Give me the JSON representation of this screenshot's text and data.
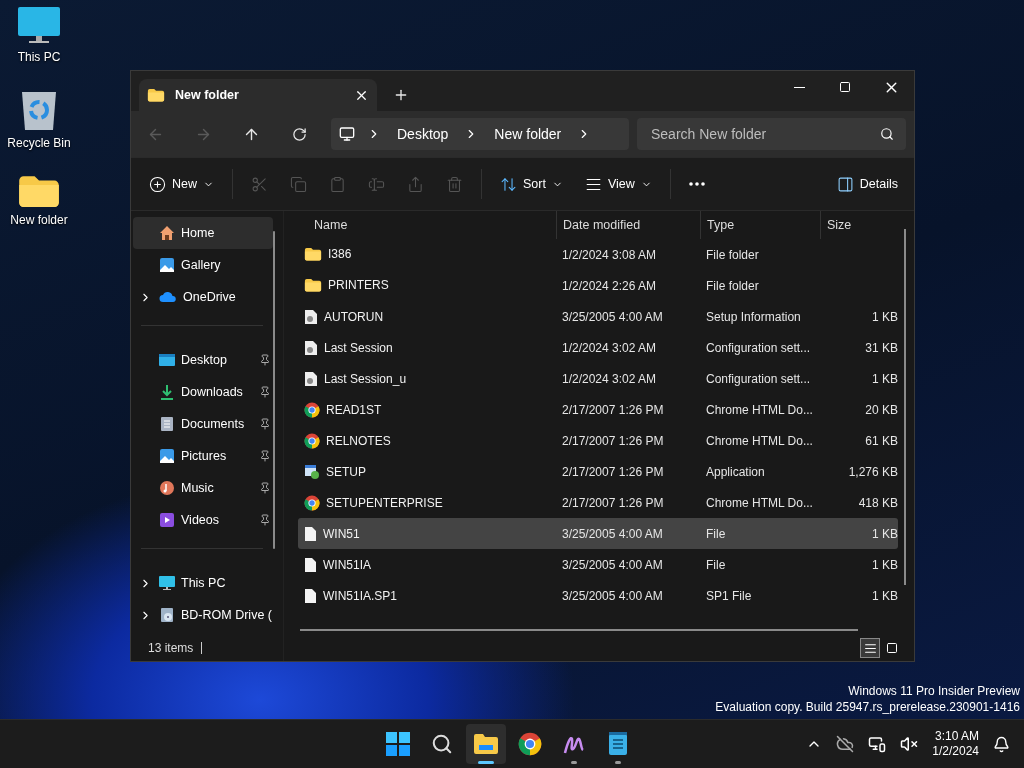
{
  "desktop_icons": [
    {
      "kind": "pc",
      "label": "This PC"
    },
    {
      "kind": "bin",
      "label": "Recycle Bin"
    },
    {
      "kind": "folder",
      "label": "New folder"
    }
  ],
  "window": {
    "tab": {
      "title": "New folder",
      "selected": true
    },
    "breadcrumb": [
      "Desktop",
      "New folder"
    ],
    "search": {
      "placeholder": "Search New folder"
    },
    "toolbar": [
      {
        "kind": "new",
        "label": "New",
        "disabled": false
      },
      {
        "kind": "cut",
        "disabled": true
      },
      {
        "kind": "copy",
        "disabled": true
      },
      {
        "kind": "paste",
        "disabled": true
      },
      {
        "kind": "rename",
        "disabled": true
      },
      {
        "kind": "share",
        "disabled": true
      },
      {
        "kind": "delete",
        "disabled": true
      },
      {
        "kind": "sort",
        "label": "Sort",
        "disabled": false
      },
      {
        "kind": "view",
        "label": "View",
        "disabled": false
      },
      {
        "kind": "more",
        "disabled": false
      },
      {
        "kind": "details",
        "label": "Details",
        "disabled": false
      }
    ],
    "sidebar": {
      "sections": [
        {
          "items": [
            {
              "kind": "home",
              "label": "Home",
              "selected": true,
              "expandable": false,
              "pinned": false
            },
            {
              "kind": "gallery",
              "label": "Gallery",
              "selected": false,
              "expandable": false,
              "pinned": false
            },
            {
              "kind": "onedrive",
              "label": "OneDrive",
              "selected": false,
              "expandable": true,
              "pinned": false
            }
          ]
        },
        {
          "items": [
            {
              "kind": "desktop",
              "label": "Desktop",
              "selected": false,
              "expandable": false,
              "pinned": true
            },
            {
              "kind": "downloads",
              "label": "Downloads",
              "selected": false,
              "expandable": false,
              "pinned": true
            },
            {
              "kind": "documents",
              "label": "Documents",
              "selected": false,
              "expandable": false,
              "pinned": true
            },
            {
              "kind": "pictures",
              "label": "Pictures",
              "selected": false,
              "expandable": false,
              "pinned": true
            },
            {
              "kind": "music",
              "label": "Music",
              "selected": false,
              "expandable": false,
              "pinned": true
            },
            {
              "kind": "videos",
              "label": "Videos",
              "selected": false,
              "expandable": false,
              "pinned": true
            }
          ]
        },
        {
          "items": [
            {
              "kind": "pc",
              "label": "This PC",
              "selected": false,
              "expandable": true,
              "pinned": false
            },
            {
              "kind": "drive",
              "label": "BD-ROM Drive (",
              "selected": false,
              "expandable": true,
              "pinned": false
            }
          ]
        }
      ]
    },
    "columns": [
      "Name",
      "Date modified",
      "Type",
      "Size"
    ],
    "rows": [
      {
        "kind": "folder",
        "name": "I386",
        "date": "1/2/2024 3:08 AM",
        "type": "File folder",
        "selected": false
      },
      {
        "kind": "folder",
        "name": "PRINTERS",
        "date": "1/2/2024 2:26 AM",
        "type": "File folder",
        "selected": false
      },
      {
        "kind": "settings",
        "name": "AUTORUN",
        "date": "3/25/2005 4:00 AM",
        "type": "Setup Information",
        "size": "1 KB",
        "selected": false
      },
      {
        "kind": "settings",
        "name": "Last Session",
        "date": "1/2/2024 3:02 AM",
        "type": "Configuration sett...",
        "size": "31 KB",
        "selected": false
      },
      {
        "kind": "settings",
        "name": "Last Session_u",
        "date": "1/2/2024 3:02 AM",
        "type": "Configuration sett...",
        "size": "1 KB",
        "selected": false
      },
      {
        "kind": "chrome",
        "name": "READ1ST",
        "date": "2/17/2007 1:26 PM",
        "type": "Chrome HTML Do...",
        "size": "20 KB",
        "selected": false
      },
      {
        "kind": "chrome",
        "name": "RELNOTES",
        "date": "2/17/2007 1:26 PM",
        "type": "Chrome HTML Do...",
        "size": "61 KB",
        "selected": false
      },
      {
        "kind": "app",
        "name": "SETUP",
        "date": "2/17/2007 1:26 PM",
        "type": "Application",
        "size": "1,276 KB",
        "selected": false
      },
      {
        "kind": "chrome",
        "name": "SETUPENTERPRISE",
        "date": "2/17/2007 1:26 PM",
        "type": "Chrome HTML Do...",
        "size": "418 KB",
        "selected": false
      },
      {
        "kind": "file",
        "name": "WIN51",
        "date": "3/25/2005 4:00 AM",
        "type": "File",
        "size": "1 KB",
        "selected": true
      },
      {
        "kind": "file",
        "name": "WIN51IA",
        "date": "3/25/2005 4:00 AM",
        "type": "File",
        "size": "1 KB",
        "selected": false
      },
      {
        "kind": "file",
        "name": "WIN51IA.SP1",
        "date": "3/25/2005 4:00 AM",
        "type": "SP1 File",
        "size": "1 KB",
        "selected": false
      }
    ],
    "status": "13 items",
    "view_buttons": [
      {
        "kind": "details",
        "selected": true
      },
      {
        "kind": "tiles",
        "selected": false
      }
    ]
  },
  "watermark": [
    "Windows 11 Pro Insider Preview",
    "Evaluation copy. Build 25947.rs_prerelease.230901-1416"
  ],
  "taskbar": {
    "apps": [
      {
        "kind": "start",
        "active": false,
        "running": false
      },
      {
        "kind": "search",
        "active": false,
        "running": false
      },
      {
        "kind": "explorer",
        "active": true,
        "running": true
      },
      {
        "kind": "chrome",
        "active": false,
        "running": false
      },
      {
        "kind": "pen",
        "active": false,
        "running": true
      },
      {
        "kind": "notepad",
        "active": false,
        "running": true
      }
    ],
    "time": "3:10 AM",
    "date": "1/2/2024"
  }
}
